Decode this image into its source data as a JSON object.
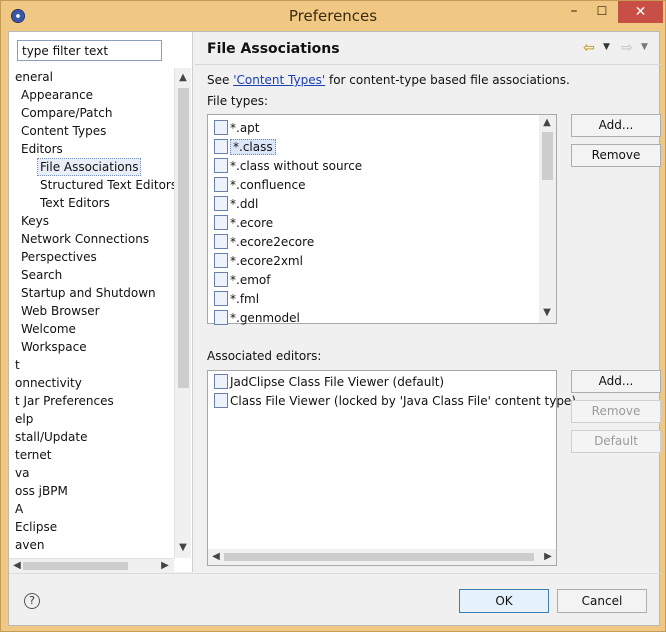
{
  "window": {
    "title": "Preferences",
    "minimize_glyph": "–",
    "maximize_glyph": "☐",
    "close_glyph": "✕"
  },
  "left": {
    "filter_value": "type filter text",
    "tree": [
      {
        "label": "eneral",
        "level": 0
      },
      {
        "label": "Appearance",
        "level": 1
      },
      {
        "label": "Compare/Patch",
        "level": 1
      },
      {
        "label": "Content Types",
        "level": 1
      },
      {
        "label": "Editors",
        "level": 1
      },
      {
        "label": "File Associations",
        "level": 2,
        "selected": true
      },
      {
        "label": "Structured Text Editors",
        "level": 2
      },
      {
        "label": "Text Editors",
        "level": 2
      },
      {
        "label": "Keys",
        "level": 1
      },
      {
        "label": "Network Connections",
        "level": 1
      },
      {
        "label": "Perspectives",
        "level": 1
      },
      {
        "label": "Search",
        "level": 1
      },
      {
        "label": "Startup and Shutdown",
        "level": 1
      },
      {
        "label": "Web Browser",
        "level": 1
      },
      {
        "label": "Welcome",
        "level": 1
      },
      {
        "label": "Workspace",
        "level": 1
      },
      {
        "label": "t",
        "level": 0
      },
      {
        "label": "onnectivity",
        "level": 0
      },
      {
        "label": "t Jar Preferences",
        "level": 0
      },
      {
        "label": "elp",
        "level": 0
      },
      {
        "label": "stall/Update",
        "level": 0
      },
      {
        "label": "ternet",
        "level": 0
      },
      {
        "label": "va",
        "level": 0
      },
      {
        "label": "oss jBPM",
        "level": 0
      },
      {
        "label": "A",
        "level": 0
      },
      {
        "label": "Eclipse",
        "level": 0
      },
      {
        "label": "aven",
        "level": 0
      }
    ]
  },
  "right": {
    "title": "File Associations",
    "nav": {
      "back_glyph": "⇦",
      "forward_glyph": "⇨",
      "menu_glyph": "▼"
    },
    "description_pre": "See ",
    "description_link": "'Content Types'",
    "description_post": " for content-type based file associations.",
    "file_types_label": "File types:",
    "file_types": [
      {
        "label": "*.apt",
        "icon": "editor-file-icon"
      },
      {
        "label": "*.class",
        "icon": "class-file-icon",
        "selected": true
      },
      {
        "label": "*.class without source",
        "icon": "class-file-icon"
      },
      {
        "label": "*.confluence",
        "icon": "editor-file-icon"
      },
      {
        "label": "*.ddl",
        "icon": "ddl-file-icon"
      },
      {
        "label": "*.ecore",
        "icon": "ecore-icon"
      },
      {
        "label": "*.ecore2ecore",
        "icon": "ecore-mapping-icon"
      },
      {
        "label": "*.ecore2xml",
        "icon": "ecore-xml-icon"
      },
      {
        "label": "*.emof",
        "icon": "ecore-icon"
      },
      {
        "label": "*.fml",
        "icon": "editor-file-icon"
      },
      {
        "label": "*.genmodel",
        "icon": "genmodel-icon"
      }
    ],
    "file_type_buttons": {
      "add": "Add...",
      "remove": "Remove"
    },
    "associated_editors_label": "Associated editors:",
    "associated_editors": [
      {
        "label": "JadClipse Class File Viewer (default)",
        "icon": "class-file-icon"
      },
      {
        "label": "Class File Viewer (locked by 'Java Class File' content type)",
        "icon": "class-file-icon"
      }
    ],
    "editor_buttons": {
      "add": "Add...",
      "remove": "Remove",
      "default": "Default"
    }
  },
  "footer": {
    "help_glyph": "?",
    "ok": "OK",
    "cancel": "Cancel"
  }
}
